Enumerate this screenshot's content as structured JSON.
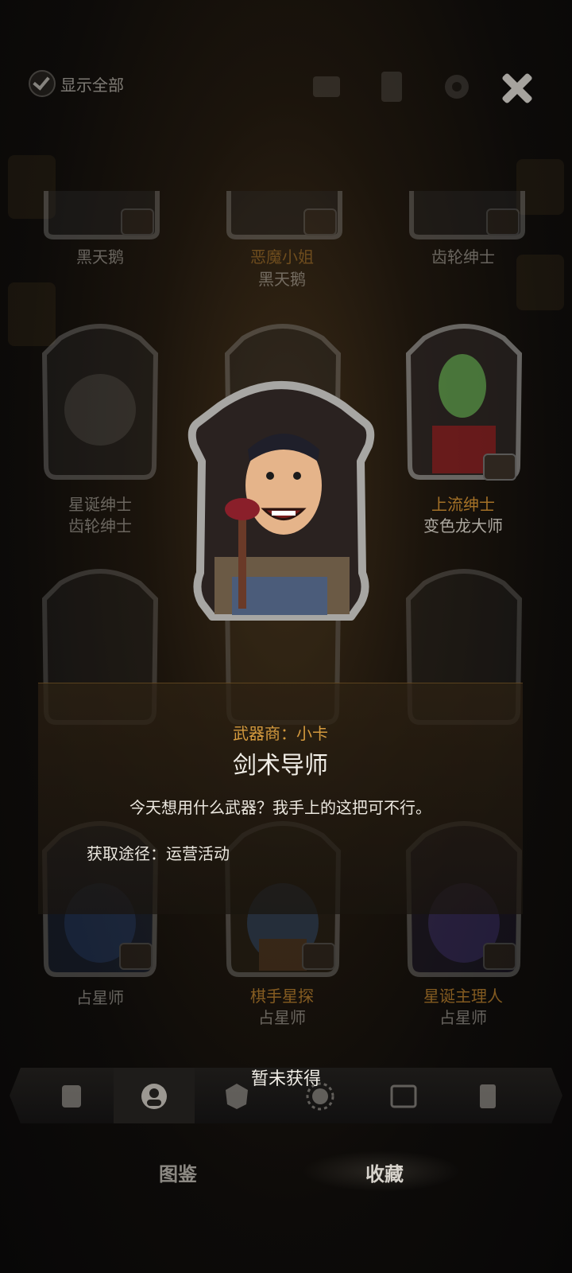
{
  "topbar": {
    "show_all_label": "显示全部"
  },
  "grid": {
    "row1": [
      {
        "line1": "",
        "line2": "黑天鹅",
        "gold": false,
        "badge": "swap"
      },
      {
        "line1": "恶魔小姐",
        "line2": "黑天鹅",
        "gold": true,
        "badge": "check"
      },
      {
        "line1": "",
        "line2": "齿轮绅士",
        "gold": false,
        "badge": "check"
      }
    ],
    "row2": [
      {
        "line1": "星诞绅士",
        "line2": "齿轮绅士",
        "gold": false,
        "badge": ""
      },
      {
        "line1": "",
        "line2": "",
        "gold": false,
        "badge": ""
      },
      {
        "line1": "上流绅士",
        "line2": "变色龙大师",
        "gold": true,
        "badge": "check"
      }
    ],
    "row4": [
      {
        "line1": "",
        "line2": "占星师",
        "gold": false,
        "badge": "swap"
      },
      {
        "line1": "棋手星探",
        "line2": "占星师",
        "gold": true,
        "badge": "swap"
      },
      {
        "line1": "星诞主理人",
        "line2": "占星师",
        "gold": true,
        "badge": "check"
      }
    ]
  },
  "detail": {
    "merchant": "武器商：小卡",
    "title": "剑术导师",
    "quote": "今天想用什么武器？我手上的这把可不行。",
    "source": "获取途径：运营活动"
  },
  "tabs": {
    "status_label": "暂未获得",
    "icons": [
      "card-icon",
      "portrait-icon",
      "emblem-icon",
      "sun-icon",
      "frame-icon",
      "deck-icon"
    ],
    "selected_index": 1
  },
  "bottom_nav": {
    "left_label": "图鉴",
    "right_label": "收藏",
    "active": "收藏"
  },
  "colors": {
    "gold": "#d49a3e",
    "accent_dim": "#b47c2b",
    "text": "#ebe7df"
  }
}
